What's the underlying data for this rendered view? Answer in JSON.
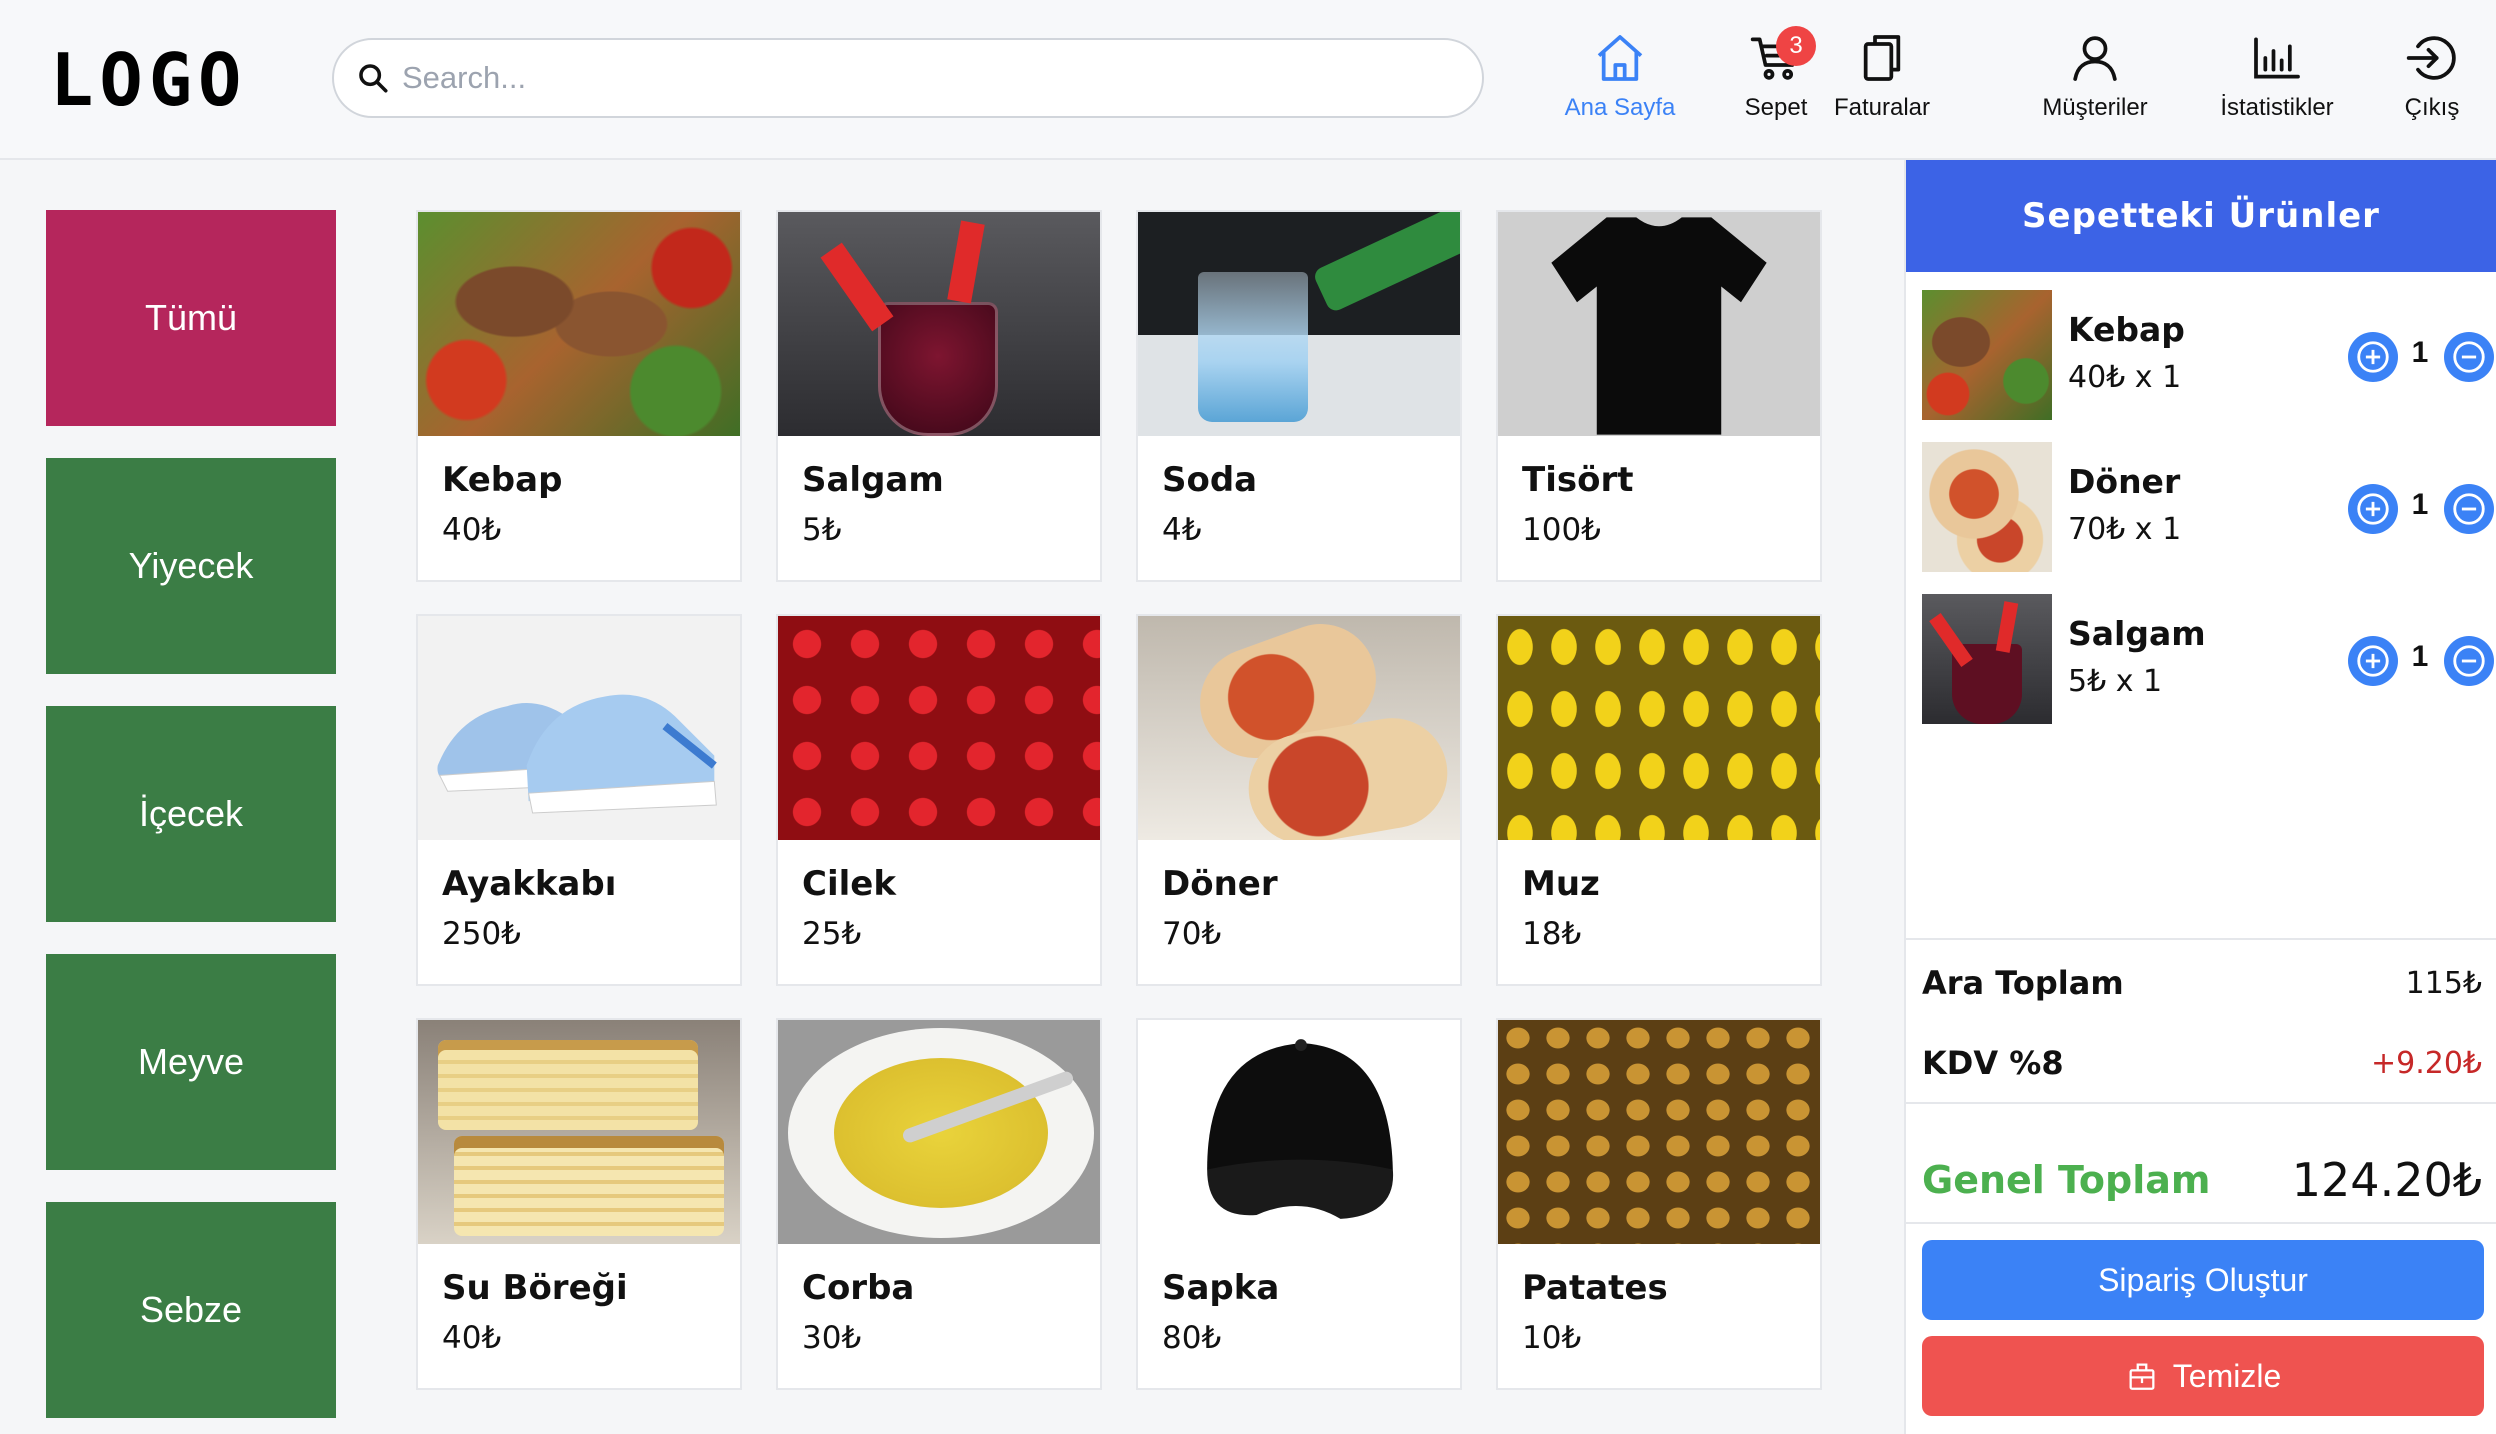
{
  "header": {
    "logo": "LOGO",
    "search_placeholder": "Search...",
    "nav": [
      {
        "label": "Ana Sayfa",
        "icon": "home-icon",
        "active": true
      },
      {
        "label": "Sepet",
        "icon": "cart-icon",
        "badge": "3"
      },
      {
        "label": "Faturalar",
        "icon": "invoices-icon"
      },
      {
        "label": "Müşteriler",
        "icon": "user-icon"
      },
      {
        "label": "İstatistikler",
        "icon": "chart-icon"
      },
      {
        "label": "Çıkış",
        "icon": "logout-icon"
      }
    ]
  },
  "categories": [
    "Tümü",
    "Yiyecek",
    "İçecek",
    "Meyve",
    "Sebze"
  ],
  "products": [
    {
      "name": "Kebap",
      "price": "40₺"
    },
    {
      "name": "Salgam",
      "price": "5₺"
    },
    {
      "name": "Soda",
      "price": "4₺"
    },
    {
      "name": "Tisört",
      "price": "100₺"
    },
    {
      "name": "Ayakkabı",
      "price": "250₺"
    },
    {
      "name": "Cilek",
      "price": "25₺"
    },
    {
      "name": "Döner",
      "price": "70₺"
    },
    {
      "name": "Muz",
      "price": "18₺"
    },
    {
      "name": "Su Böreği",
      "price": "40₺"
    },
    {
      "name": "Corba",
      "price": "30₺"
    },
    {
      "name": "Sapka",
      "price": "80₺"
    },
    {
      "name": "Patates",
      "price": "10₺"
    }
  ],
  "cart": {
    "title": "Sepetteki Ürünler",
    "items": [
      {
        "name": "Kebap",
        "line": "40₺ x 1",
        "qty": "1"
      },
      {
        "name": "Döner",
        "line": "70₺ x 1",
        "qty": "1"
      },
      {
        "name": "Salgam",
        "line": "5₺ x 1",
        "qty": "1"
      }
    ],
    "subtotal_label": "Ara Toplam",
    "subtotal_value": "115₺",
    "tax_label": "KDV %8",
    "tax_value": "+9.20₺",
    "total_label": "Genel Toplam",
    "total_value": "124.20₺",
    "order_button": "Sipariş Oluştur",
    "clear_button": "Temizle"
  },
  "colors": {
    "accent": "#3b82f6",
    "header_blue": "#3c63e6",
    "category_all": "#b5265c",
    "category_green": "#3b7d45",
    "badge": "#ef4444",
    "total_green": "#4cb04f",
    "tax_red": "#c62828",
    "clear_red": "#ef5350"
  }
}
